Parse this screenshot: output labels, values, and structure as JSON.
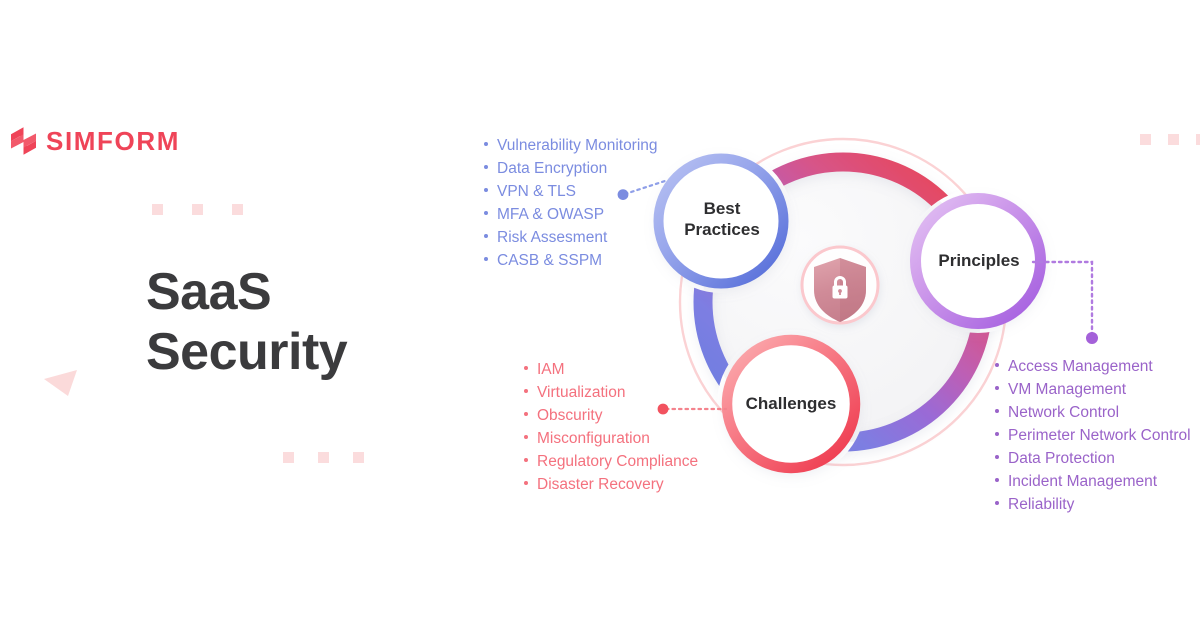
{
  "brand": {
    "name": "SIMFORM",
    "logo_icon": "simform-s-mark-icon",
    "color": "#ef4458"
  },
  "headline": {
    "line1": "SaaS",
    "line2": "Security",
    "color": "#3b3b3d"
  },
  "diagram": {
    "center_icon": "shield-lock-icon",
    "center_shield_color": "#d98a96",
    "nodes": [
      {
        "id": "best-practices",
        "label_line1": "Best",
        "label_line2": "Practices",
        "color": "#6c7fe0"
      },
      {
        "id": "principles",
        "label_line1": "Principles",
        "label_line2": "",
        "color": "#a566dd"
      },
      {
        "id": "challenges",
        "label_line1": "Challenges",
        "label_line2": "",
        "color": "#f25563"
      }
    ],
    "ring_gradient": [
      "#7b8ce0",
      "#a566dd",
      "#c65ba8",
      "#e8475a",
      "#f25563"
    ],
    "outer_ring_color": "#fbd2d4"
  },
  "lists": {
    "best_practices": {
      "color": "#7b8ce0",
      "items": [
        "Vulnerability Monitoring",
        "Data Encryption",
        "VPN & TLS",
        "MFA & OWASP",
        "Risk Assesment",
        "CASB & SSPM"
      ]
    },
    "challenges": {
      "color": "#f4717e",
      "items": [
        "IAM",
        "Virtualization",
        "Obscurity",
        "Misconfiguration",
        "Regulatory Compliance",
        "Disaster Recovery"
      ]
    },
    "principles": {
      "color": "#9a63c9",
      "items": [
        "Access Management",
        "VM Management",
        "Network Control",
        "Perimeter Network Control",
        "Data Protection",
        "Incident Management",
        "Reliability"
      ]
    }
  },
  "decorations": {
    "square_color": "#fbdcdd",
    "triangle_color": "#fbdada"
  }
}
